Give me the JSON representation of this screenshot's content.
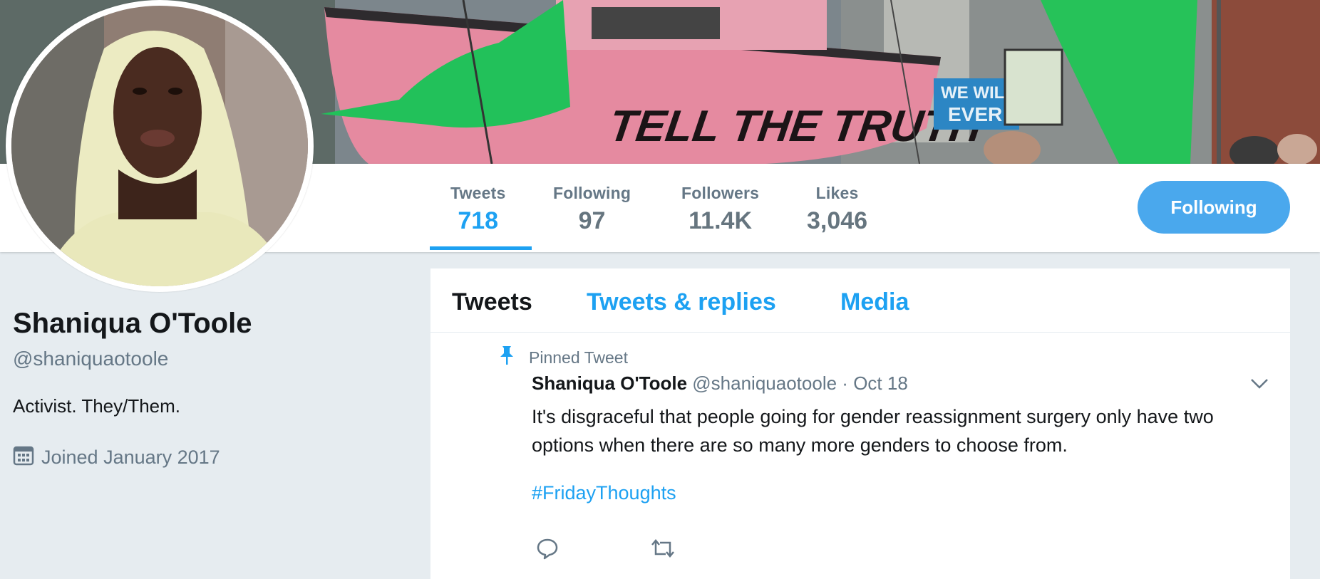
{
  "banner": {
    "boat_text": "TELL THE TRUTH",
    "sign_text_1": "WE WILL",
    "sign_text_2": "EVER",
    "colors": {
      "boat_pink": "#e58aa0",
      "flag_green": "#22c15a"
    }
  },
  "profile": {
    "name": "Shaniqua O'Toole",
    "handle": "@shaniquaotoole",
    "bio": "Activist. They/Them.",
    "joined": "Joined January 2017",
    "joined_icon": "calendar-icon"
  },
  "stats": [
    {
      "label": "Tweets",
      "value": "718",
      "active": true
    },
    {
      "label": "Following",
      "value": "97",
      "active": false
    },
    {
      "label": "Followers",
      "value": "11.4K",
      "active": false
    },
    {
      "label": "Likes",
      "value": "3,046",
      "active": false
    }
  ],
  "follow_button": {
    "label": "Following",
    "color": "#4aa8ed"
  },
  "tabs": [
    {
      "label": "Tweets",
      "active": true
    },
    {
      "label": "Tweets & replies",
      "active": false
    },
    {
      "label": "Media",
      "active": false
    }
  ],
  "tweet": {
    "pinned_label": "Pinned Tweet",
    "pinned_icon": "pin-icon",
    "author_name": "Shaniqua O'Toole",
    "author_handle": "@shaniquaotoole",
    "separator": "·",
    "date": "Oct 18",
    "text": "It's disgraceful that people going for gender reassignment surgery only have two options when there are so many more genders to choose from.",
    "hashtag": "#FridayThoughts",
    "actions": [
      "reply-icon",
      "retweet-icon"
    ]
  },
  "accent_color": "#1da1f2"
}
